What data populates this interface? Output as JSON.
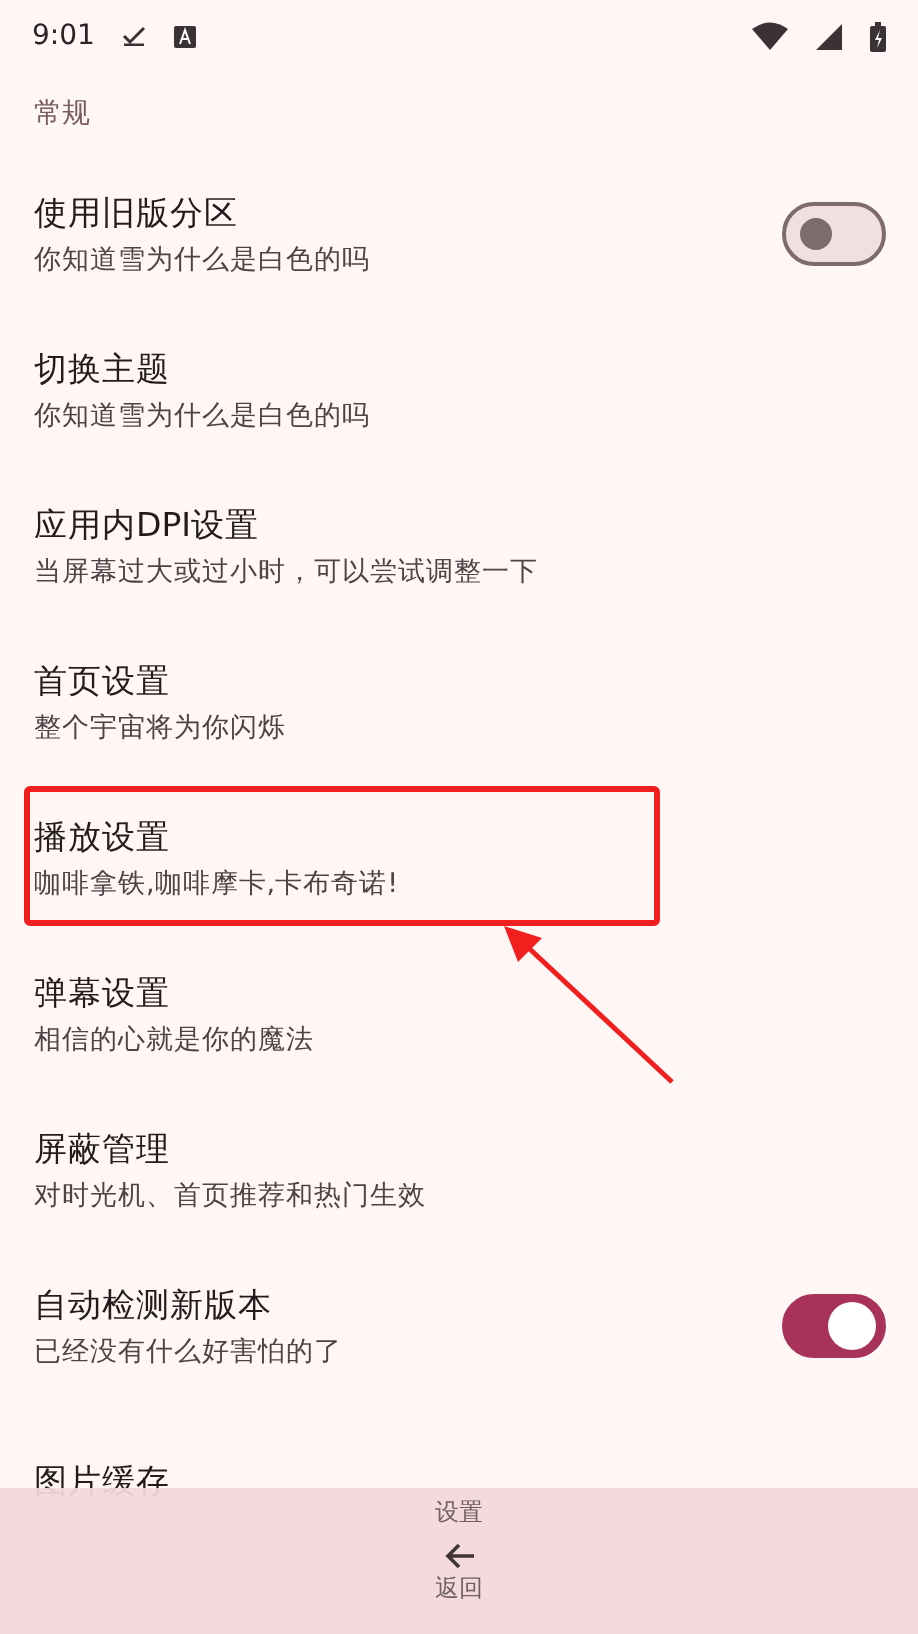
{
  "status_bar": {
    "time": "9:01"
  },
  "section_title": "常规",
  "items": [
    {
      "kind": "switch",
      "title": "使用旧版分区",
      "subtitle": "你知道雪为什么是白色的吗",
      "on": false
    },
    {
      "kind": "plain",
      "title": "切换主题",
      "subtitle": "你知道雪为什么是白色的吗"
    },
    {
      "kind": "plain",
      "title": "应用内DPI设置",
      "subtitle": "当屏幕过大或过小时，可以尝试调整一下"
    },
    {
      "kind": "plain",
      "title": "首页设置",
      "subtitle": "整个宇宙将为你闪烁"
    },
    {
      "kind": "plain",
      "title": "播放设置",
      "subtitle": "咖啡拿铁,咖啡摩卡,卡布奇诺!",
      "highlighted": true
    },
    {
      "kind": "plain",
      "title": "弹幕设置",
      "subtitle": "相信的心就是你的魔法"
    },
    {
      "kind": "plain",
      "title": "屏蔽管理",
      "subtitle": "对时光机、首页推荐和热门生效"
    },
    {
      "kind": "switch",
      "title": "自动检测新版本",
      "subtitle": "已经没有什么好害怕的了",
      "on": true
    },
    {
      "kind": "plain",
      "title": "图片缓存"
    }
  ],
  "bottom_bar": {
    "title": "设置",
    "back_label": "返回"
  }
}
